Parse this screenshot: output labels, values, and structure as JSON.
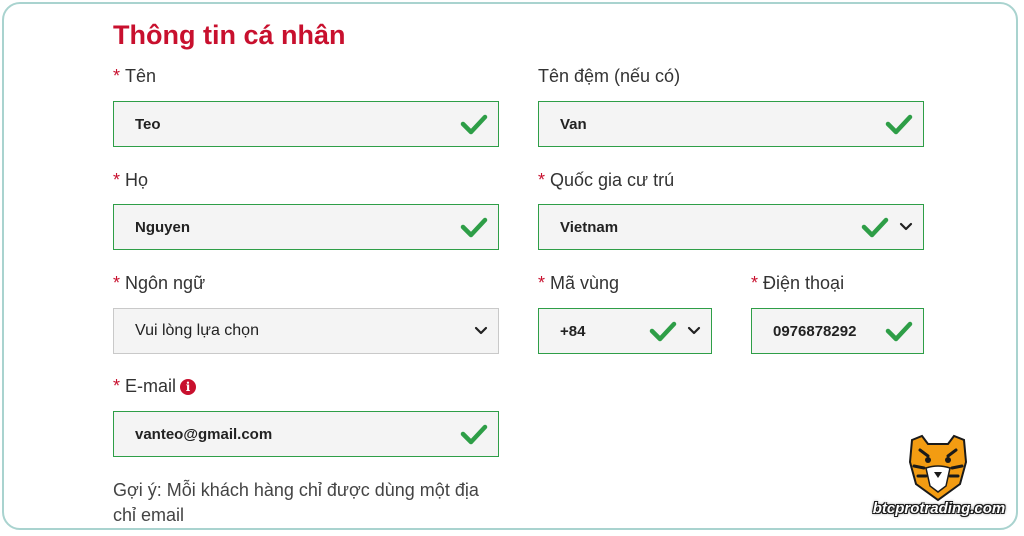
{
  "section_title": "Thông tin cá nhân",
  "required_marker": "*",
  "fields": {
    "first_name": {
      "label": "Tên",
      "value": "Teo"
    },
    "middle_name": {
      "label": "Tên đệm (nếu có)",
      "value": "Van"
    },
    "last_name": {
      "label": "Họ",
      "value": "Nguyen"
    },
    "country": {
      "label": "Quốc gia cư trú",
      "value": "Vietnam"
    },
    "language": {
      "label": "Ngôn ngữ",
      "value": "Vui lòng lựa chọn"
    },
    "area_code": {
      "label": "Mã vùng",
      "value": "+84"
    },
    "phone": {
      "label": "Điện thoại",
      "value": "0976878292"
    },
    "email": {
      "label": "E-mail",
      "value": "vanteo@gmail.com"
    }
  },
  "info_icon_glyph": "i",
  "hint": "Gợi ý: Mỗi khách hàng chỉ được dùng một địa chỉ email",
  "watermark": {
    "text": "btcprotrading.com",
    "icon": "tiger-head-icon"
  },
  "colors": {
    "accent_red": "#c8102e",
    "valid_green": "#2e9e47",
    "frame": "#a9d3cf"
  }
}
